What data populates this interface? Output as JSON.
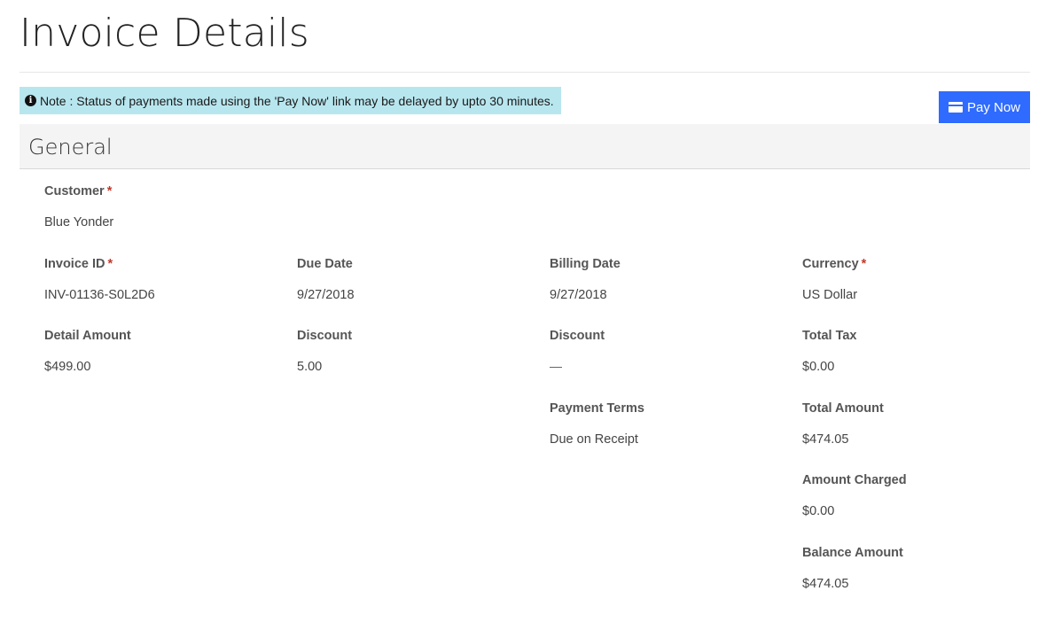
{
  "page": {
    "title": "Invoice Details"
  },
  "notice": {
    "text": "Note : Status of payments made using the 'Pay Now' link may be delayed by upto 30 minutes.",
    "icon": "info-circle-icon",
    "background": "#b8e6ee"
  },
  "pay_now": {
    "label": "Pay Now",
    "icon": "credit-card-icon",
    "color": "#2f6bff"
  },
  "section": {
    "title": "General"
  },
  "required_marker": "*",
  "fields": {
    "customer": {
      "label": "Customer",
      "value": "Blue Yonder"
    },
    "invoice_id": {
      "label": "Invoice ID",
      "value": "INV-01136-S0L2D6"
    },
    "due_date": {
      "label": "Due Date",
      "value": "9/27/2018"
    },
    "billing_date": {
      "label": "Billing Date",
      "value": "9/27/2018"
    },
    "currency": {
      "label": "Currency",
      "value": "US Dollar"
    },
    "detail_amount": {
      "label": "Detail Amount",
      "value": "$499.00"
    },
    "discount_percent": {
      "label": "Discount",
      "value": "5.00"
    },
    "discount_amount": {
      "label": "Discount",
      "value": ""
    },
    "total_tax": {
      "label": "Total Tax",
      "value": "$0.00"
    },
    "payment_terms": {
      "label": "Payment Terms",
      "value": "Due on Receipt"
    },
    "total_amount": {
      "label": "Total Amount",
      "value": "$474.05"
    },
    "amount_charged": {
      "label": "Amount Charged",
      "value": "$0.00"
    },
    "balance_amount": {
      "label": "Balance Amount",
      "value": "$474.05"
    }
  }
}
